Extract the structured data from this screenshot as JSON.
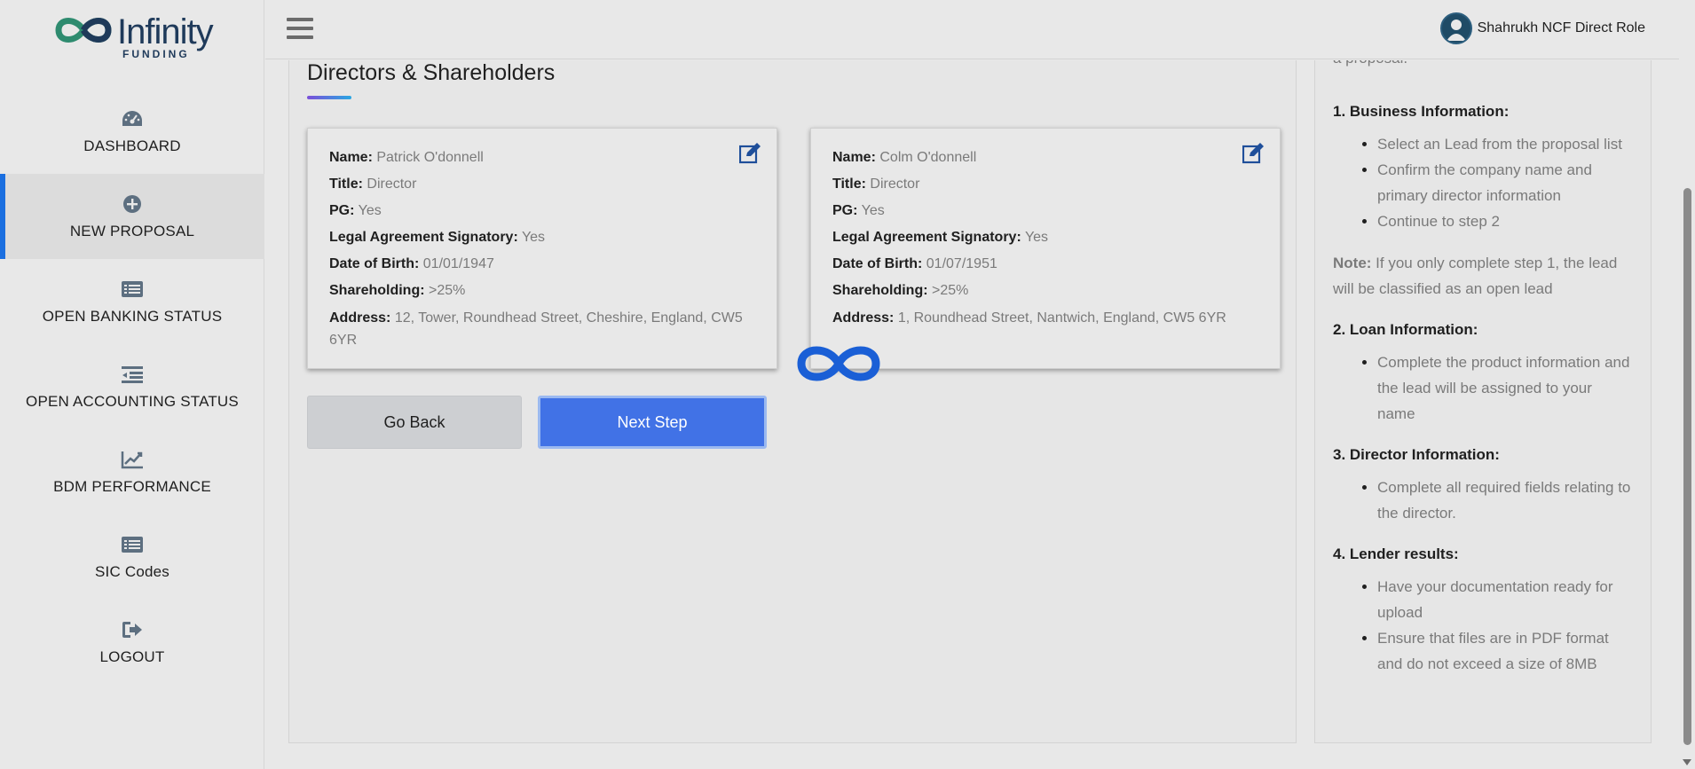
{
  "app": {
    "logo_text": "Infinity",
    "logo_sub": "FUNDING",
    "accent_color": "#1b6fe0",
    "primary_button_color": "#4172e6"
  },
  "sidebar": {
    "items": [
      {
        "label": "DASHBOARD",
        "icon": "dashboard-icon",
        "active": false
      },
      {
        "label": "NEW PROPOSAL",
        "icon": "plus-circle-icon",
        "active": true
      },
      {
        "label": "OPEN BANKING STATUS",
        "icon": "list-icon",
        "active": false
      },
      {
        "label": "OPEN ACCOUNTING STATUS",
        "icon": "indent-icon",
        "active": false
      },
      {
        "label": "BDM PERFORMANCE",
        "icon": "chart-line-icon",
        "active": false
      },
      {
        "label": "SIC Codes",
        "icon": "list-icon",
        "active": false
      },
      {
        "label": "LOGOUT",
        "icon": "logout-icon",
        "active": false
      }
    ]
  },
  "header": {
    "user_name": "Shahrukh NCF Direct Role"
  },
  "main": {
    "section_title": "Directors & Shareholders",
    "labels": {
      "name": "Name:",
      "title": "Title:",
      "pg": "PG:",
      "signatory": "Legal Agreement Signatory:",
      "dob": "Date of Birth:",
      "shareholding": "Shareholding:",
      "address": "Address:"
    },
    "directors": [
      {
        "name": "Patrick O'donnell",
        "title": "Director",
        "pg": "Yes",
        "signatory": "Yes",
        "dob": "01/01/1947",
        "shareholding": ">25%",
        "address": "12, Tower, Roundhead Street, Cheshire, England, CW5 6YR"
      },
      {
        "name": "Colm O'donnell",
        "title": "Director",
        "pg": "Yes",
        "signatory": "Yes",
        "dob": "01/07/1951",
        "shareholding": ">25%",
        "address": "1, Roundhead Street, Nantwich, England, CW5 6YR"
      }
    ],
    "back_label": "Go Back",
    "next_label": "Next Step"
  },
  "help": {
    "cut_text": "a proposal.",
    "step1_title": "1. Business Information:",
    "step1_items": [
      "Select an Lead from the proposal list",
      "Confirm the company name and primary director information",
      "Continue to step 2"
    ],
    "note_label": "Note:",
    "note_text": " If you only complete step 1, the lead will be classified as an open lead",
    "step2_title": "2. Loan Information:",
    "step2_items": [
      "Complete the product information and the lead will be assigned to your name"
    ],
    "step3_title": "3. Director Information:",
    "step3_items": [
      "Complete all required fields relating to the director."
    ],
    "step4_title": "4. Lender results:",
    "step4_items": [
      "Have your documentation ready for upload",
      "Ensure that files are in PDF format and do not exceed a size of 8MB"
    ]
  }
}
